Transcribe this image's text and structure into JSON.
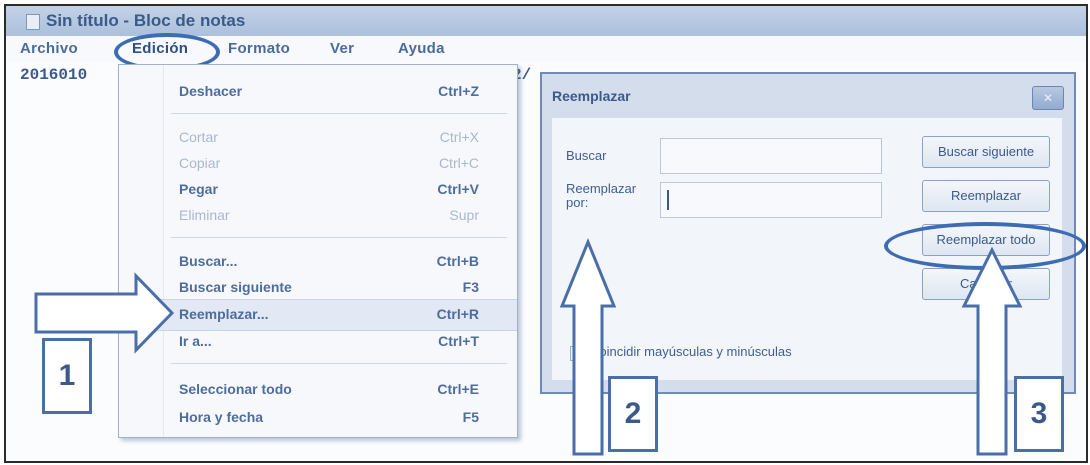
{
  "window": {
    "title": "Sin título - Bloc de notas"
  },
  "menubar": {
    "archivo": "Archivo",
    "edicion": "Edición",
    "formato": "Formato",
    "ver": "Ver",
    "ayuda": "Ayuda"
  },
  "document": {
    "text": "2016010",
    "text_right": "2/"
  },
  "edit_menu": {
    "items": [
      {
        "label": "Deshacer",
        "shortcut": "Ctrl+Z",
        "enabled": true
      },
      {
        "label": "Cortar",
        "shortcut": "Ctrl+X",
        "enabled": false
      },
      {
        "label": "Copiar",
        "shortcut": "Ctrl+C",
        "enabled": false
      },
      {
        "label": "Pegar",
        "shortcut": "Ctrl+V",
        "enabled": true
      },
      {
        "label": "Eliminar",
        "shortcut": "Supr",
        "enabled": false
      },
      {
        "label": "Buscar...",
        "shortcut": "Ctrl+B",
        "enabled": true
      },
      {
        "label": "Buscar siguiente",
        "shortcut": "F3",
        "enabled": true
      },
      {
        "label": "Reemplazar...",
        "shortcut": "Ctrl+R",
        "enabled": true,
        "highlighted": true
      },
      {
        "label": "Ir a...",
        "shortcut": "Ctrl+T",
        "enabled": true
      },
      {
        "label": "Seleccionar todo",
        "shortcut": "Ctrl+E",
        "enabled": true
      },
      {
        "label": "Hora y fecha",
        "shortcut": "F5",
        "enabled": true
      }
    ]
  },
  "replace_dialog": {
    "title": "Reemplazar",
    "close_icon": "close-icon",
    "find_label": "Buscar",
    "find_value": "",
    "replace_label": "Reemplazar por:",
    "replace_value": "",
    "match_case_label": "Coincidir mayúsculas y minúsculas",
    "match_case_checked": false,
    "buttons": {
      "find_next": "Buscar siguiente",
      "replace": "Reemplazar",
      "replace_all": "Reemplazar todo",
      "cancel": "Cancelar"
    }
  },
  "annotations": {
    "step_1": "1",
    "step_2": "2",
    "step_3": "3",
    "accent_color": "#3d6cb4"
  }
}
